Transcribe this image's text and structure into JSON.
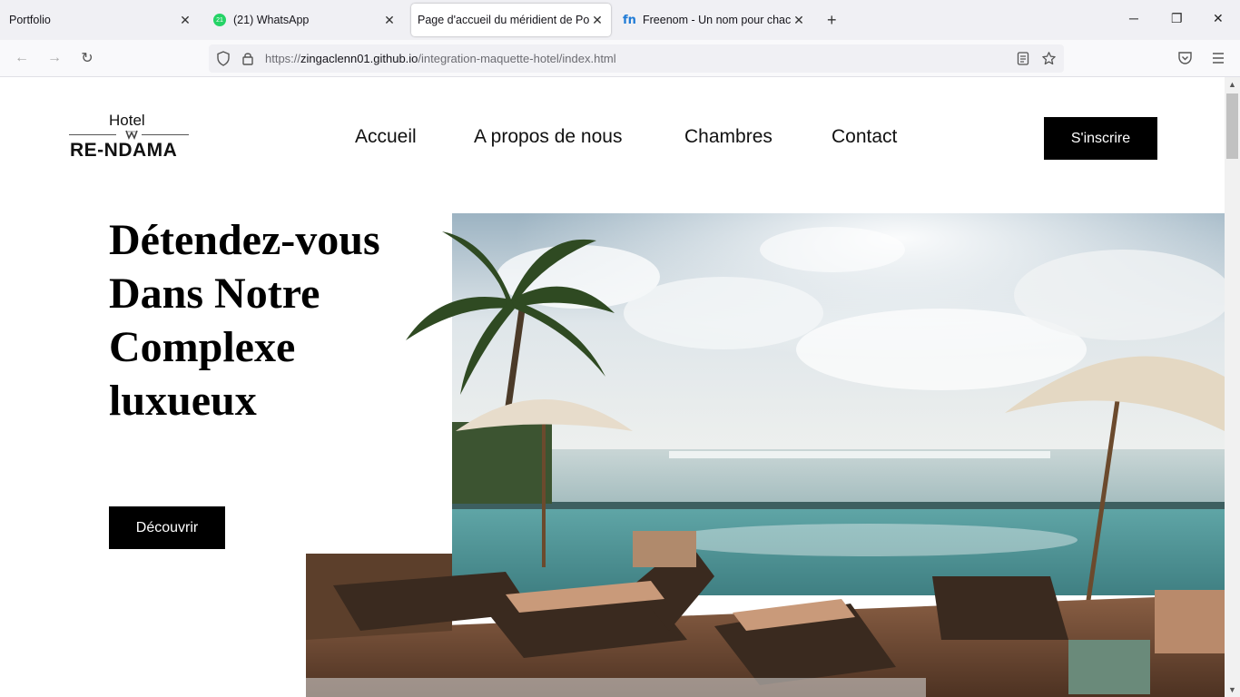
{
  "browser": {
    "tabs": [
      {
        "label": "Portfolio"
      },
      {
        "label": "(21) WhatsApp",
        "badge": "21"
      },
      {
        "label": "Page d'accueil du méridient de Port"
      },
      {
        "label": "Freenom - Un nom pour chacun"
      }
    ],
    "url": {
      "scheme": "https://",
      "host": "zingaclenn01.github.io",
      "path": "/integration-maquette-hotel/index.html"
    }
  },
  "site": {
    "logo": {
      "line1": "Hotel",
      "line2": "RE-NDAMA"
    },
    "menu": [
      "Accueil",
      "A propos de nous",
      "Chambres",
      "Contact"
    ],
    "signup_label": "S'inscrire",
    "hero": {
      "title_lines": [
        "Détendez-vous",
        "Dans Notre",
        "Complexe",
        "luxueux"
      ],
      "cta_label": "Découvrir"
    }
  },
  "colors": {
    "primary": "#000000",
    "background": "#ffffff",
    "tabbar": "#f0f0f4"
  }
}
